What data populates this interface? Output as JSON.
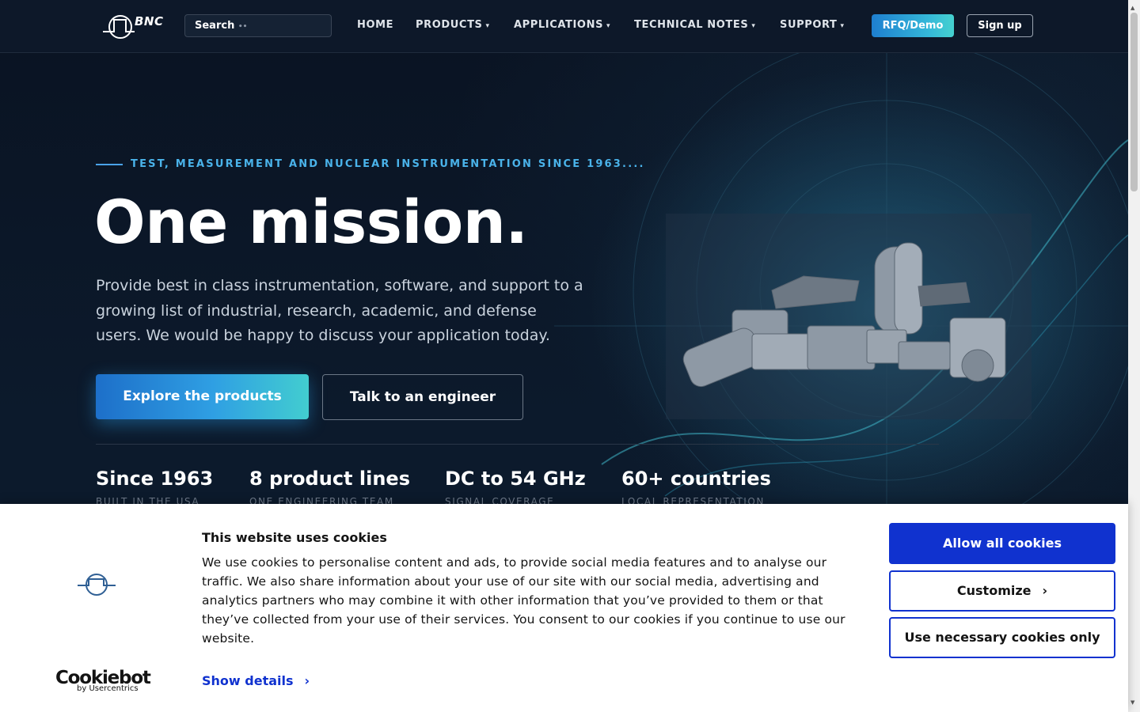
{
  "navbar": {
    "logo_text": "BNC",
    "search": {
      "label": "Search",
      "dots": "••"
    },
    "menu": [
      {
        "label": "HOME",
        "caret": ""
      },
      {
        "label": "PRODUCTS",
        "caret": "▾"
      },
      {
        "label": "APPLICATIONS",
        "caret": "▾"
      },
      {
        "label": "TECHNICAL NOTES",
        "caret": "▾"
      },
      {
        "label": "SUPPORT",
        "caret": "▾"
      }
    ],
    "rfq_label": "RFQ/Demo",
    "signup_label": "Sign up"
  },
  "hero": {
    "eyebrow": "TEST, MEASUREMENT AND NUCLEAR INSTRUMENTATION SINCE 1963....",
    "headline": "One mission.",
    "subtext": "Provide best in class instrumentation, software, and support to a growing list of industrial, research, academic, and defense users. We would be happy to discuss your application today.",
    "primary_cta": "Explore the products",
    "secondary_cta": "Talk to an engineer",
    "stats": [
      {
        "value": "Since 1963",
        "label": "BUILT IN THE USA"
      },
      {
        "value": "8 product lines",
        "label": "ONE ENGINEERING TEAM"
      },
      {
        "value": "DC to 54 GHz",
        "label": "SIGNAL COVERAGE"
      },
      {
        "value": "60+ countries",
        "label": "LOCAL REPRESENTATION"
      }
    ]
  },
  "cookie_banner": {
    "title": "This website uses cookies",
    "text": "We use cookies to personalise content and ads, to provide social media features and to analyse our traffic. We also share information about your use of our site with our social media, advertising and analytics partners who may combine it with other information that you’ve provided to them or that they’ve collected from your use of their services. You consent to our cookies if you continue to use our website.",
    "show_details": "Show details",
    "allow_all": "Allow all cookies",
    "customize": "Customize",
    "necessary_only": "Use necessary cookies only",
    "brand": "Cookiebot",
    "brand_sub": "by Usercentrics"
  },
  "colors": {
    "background": "#0b1424",
    "accent_gradient_start": "#1d6fc9",
    "accent_gradient_end": "#42cdd0",
    "eyebrow": "#4ab3ea",
    "cookie_primary": "#1032cf"
  },
  "icons": {
    "logo": "pulse-circle-logo",
    "caret": "caret-down-icon",
    "chevron": "chevron-right-icon"
  }
}
